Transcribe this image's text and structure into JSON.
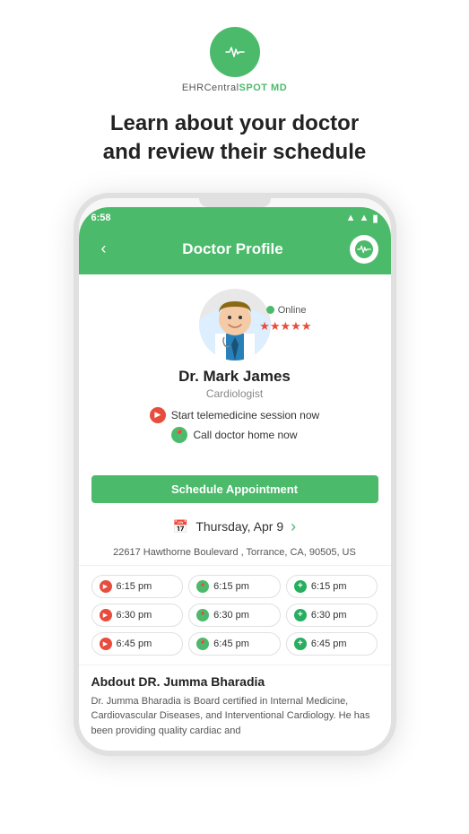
{
  "logo": {
    "brand_prefix": "EHRCentral",
    "brand_suffix": "SPOT MD"
  },
  "headline": {
    "line1": "Learn about your doctor",
    "line2": "and review their schedule"
  },
  "status_bar": {
    "time": "6:58",
    "signal": "▲",
    "wifi": "WiFi",
    "battery": "Battery"
  },
  "header": {
    "title": "Doctor Profile",
    "back_label": "‹"
  },
  "doctor": {
    "online_label": "Online",
    "stars": "★★★★★",
    "name": "Dr. Mark James",
    "specialty": "Cardiologist",
    "tele_action": "Start telemedicine session now",
    "call_action": "Call doctor home now"
  },
  "schedule_btn": "Schedule Appointment",
  "date": {
    "icon": "📅",
    "label": "Thursday, Apr 9",
    "nav_right": "›"
  },
  "address": "22617 Hawthorne Boulevard , Torrance, CA, 90505, US",
  "time_slots": [
    {
      "type": "video",
      "time": "6:15 pm"
    },
    {
      "type": "location",
      "time": "6:15 pm"
    },
    {
      "type": "plus",
      "time": "6:15 pm"
    },
    {
      "type": "video",
      "time": "6:30 pm"
    },
    {
      "type": "location",
      "time": "6:30 pm"
    },
    {
      "type": "plus",
      "time": "6:30 pm"
    },
    {
      "type": "video",
      "time": "6:45 pm"
    },
    {
      "type": "location",
      "time": "6:45 pm"
    },
    {
      "type": "plus",
      "time": "6:45 pm"
    }
  ],
  "about": {
    "title": "Abdout DR. Jumma Bharadia",
    "text": "Dr. Jumma Bharadia is Board certified in Internal Medicine, Cardiovascular Diseases, and Interventional Cardiology. He has been providing quality cardiac and"
  }
}
